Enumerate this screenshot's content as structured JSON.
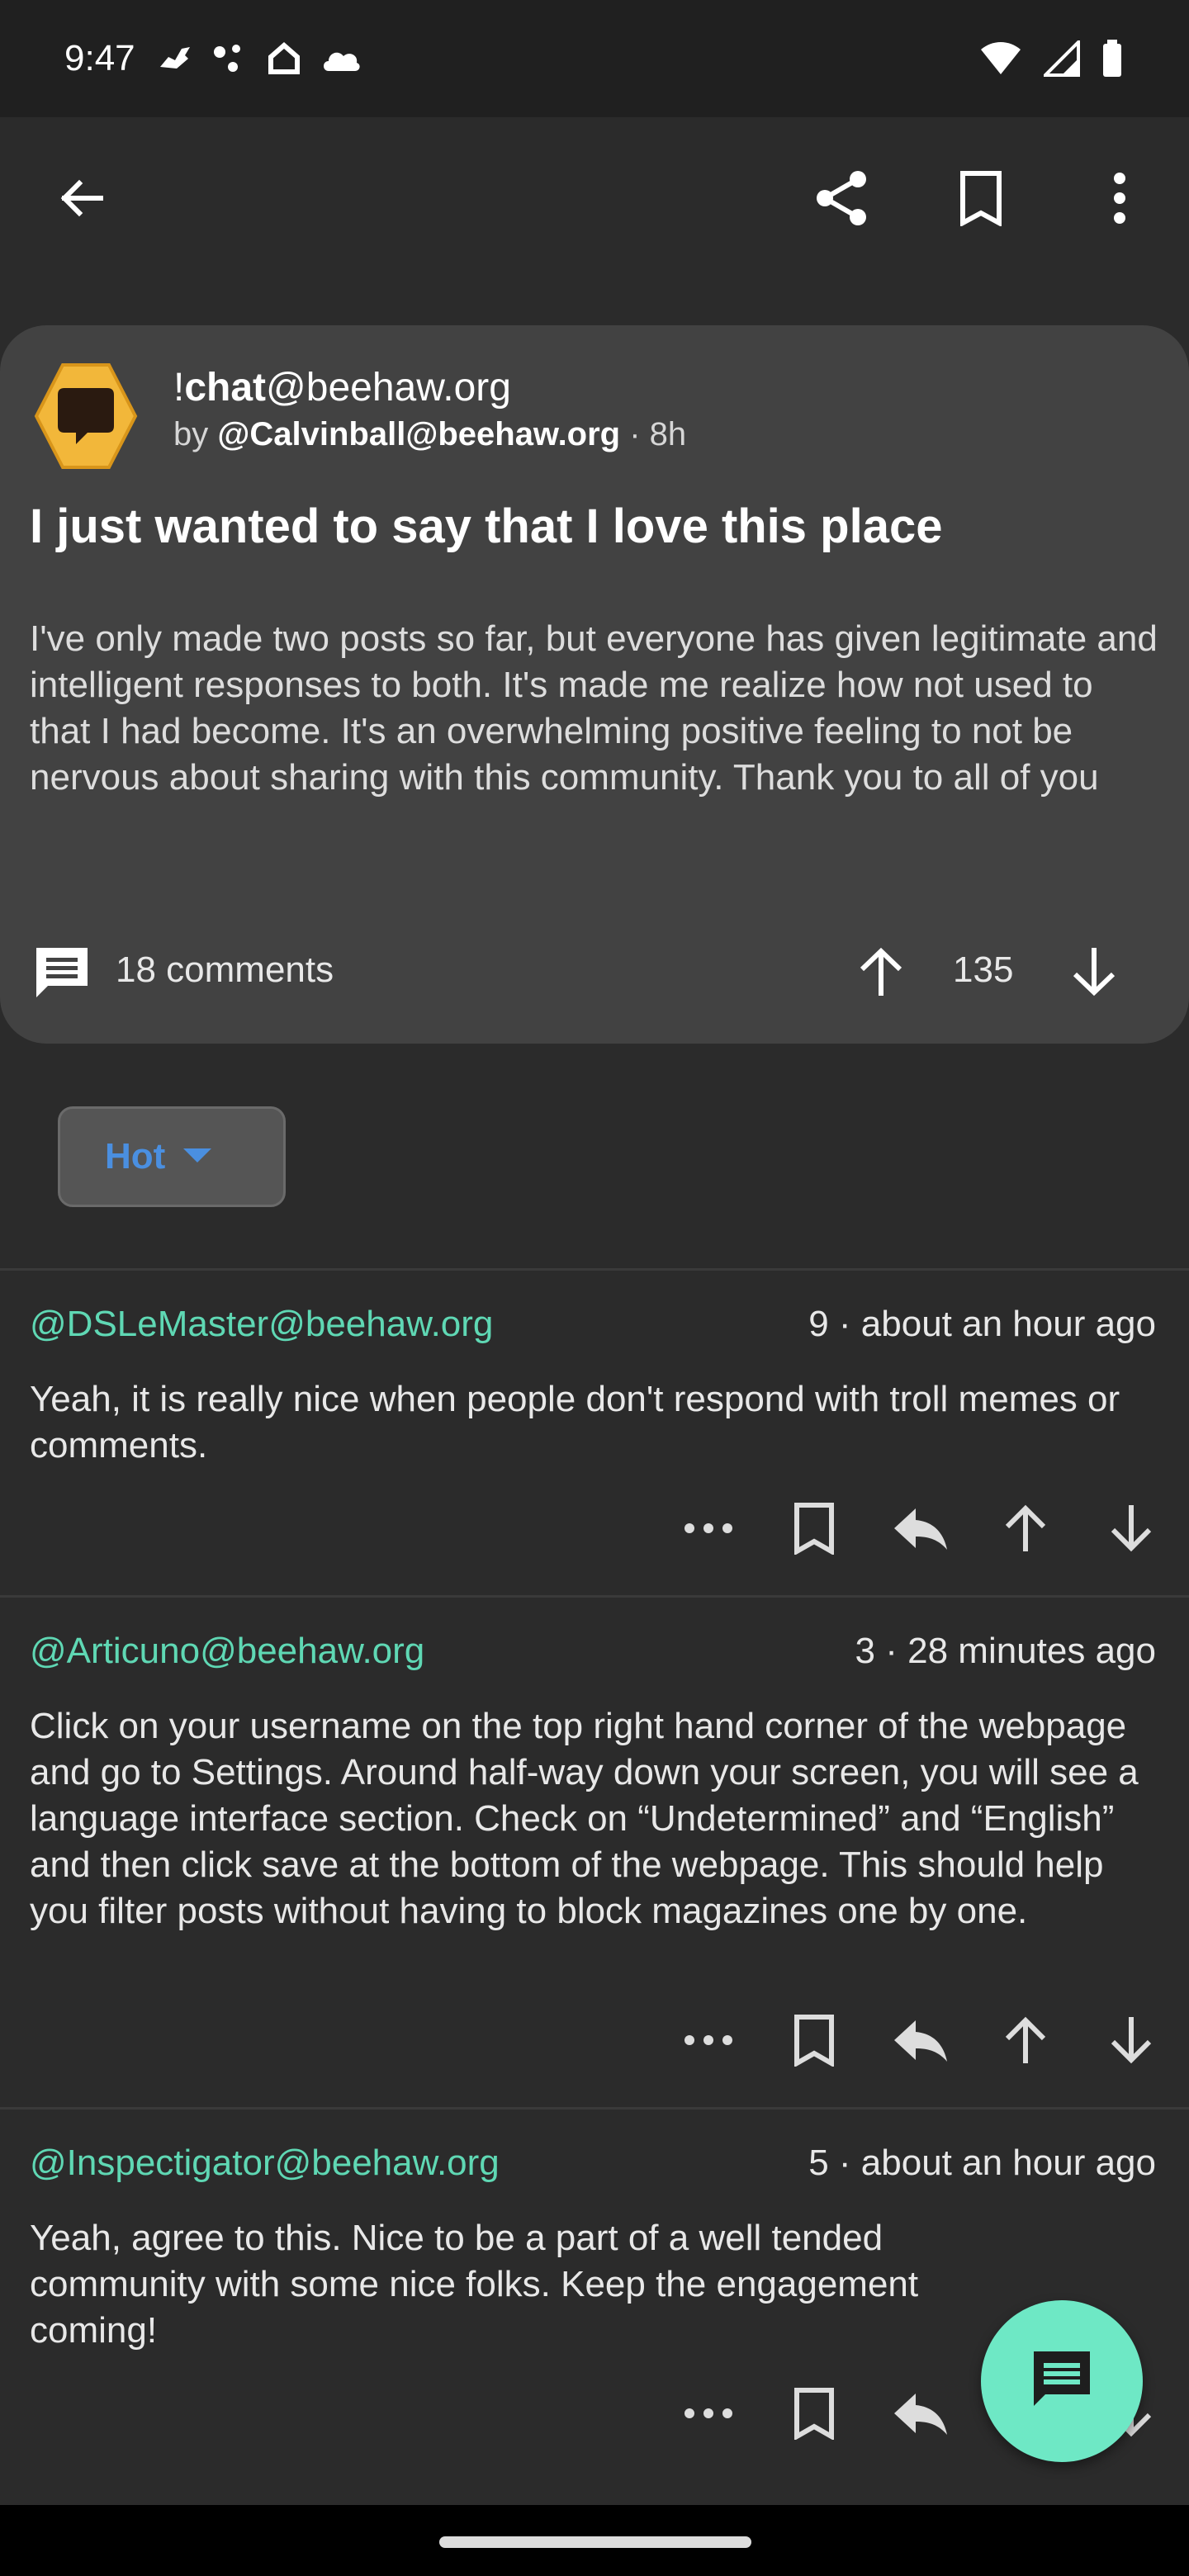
{
  "status_bar": {
    "time": "9:47"
  },
  "post": {
    "community_prefix": "!",
    "community_name": "chat",
    "community_instance": "@beehaw.org",
    "by_label": "by",
    "author": "@Calvinball@beehaw.org",
    "age": "· 8h",
    "title": "I just wanted to say that I love this place",
    "body": "I've only made two posts so far, but everyone has given legitimate and intelligent responses to both. It's made me realize how not used to that I had become. It's an overwhelming positive feeling to not be nervous about sharing with this community. Thank you to all of you",
    "comments_label": "18 comments",
    "score": "135"
  },
  "sort": {
    "label": "Hot"
  },
  "comments": [
    {
      "author": "@DSLeMaster@beehaw.org",
      "info": "9 · about an hour ago",
      "text": "Yeah, it is really nice when people don't respond with troll memes or comments."
    },
    {
      "author": "@Articuno@beehaw.org",
      "info": "3 · 28 minutes ago",
      "text": "Click on your username on the top right hand corner of the webpage and go to Settings. Around half-way down your screen, you will see a language interface section. Check on “Undetermined” and “English” and then click save at the bottom of the webpage. This should help you filter posts without having to block magazines one by one."
    },
    {
      "author": "@Inspectigator@beehaw.org",
      "info": "5 · about an hour ago",
      "text": "Yeah, agree to this.  Nice to be a part of a well tended community with some nice folks.  Keep the engagement coming!"
    }
  ],
  "colors": {
    "author_accent": "#5fd8b4",
    "sort_accent": "#4a8fe0",
    "fab": "#6ee8c5",
    "avatar": "#f2b73a"
  },
  "icons": [
    "back-arrow-icon",
    "share-icon",
    "bookmark-icon",
    "more-vert-icon",
    "comment-icon",
    "upvote-icon",
    "downvote-icon",
    "more-horiz-icon",
    "reply-icon",
    "dropdown-icon",
    "chat-icon"
  ]
}
